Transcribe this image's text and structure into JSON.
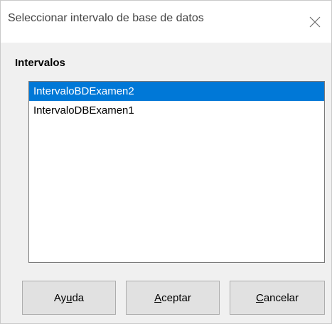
{
  "dialog": {
    "title": "Seleccionar intervalo de base de datos"
  },
  "ranges": {
    "label": "Intervalos",
    "items": [
      {
        "label": "IntervaloBDExamen2",
        "selected": true
      },
      {
        "label": "IntervaloDBExamen1",
        "selected": false
      }
    ]
  },
  "buttons": {
    "help": {
      "pre": "Ay",
      "mnemonic": "u",
      "post": "da"
    },
    "ok": {
      "pre": "",
      "mnemonic": "A",
      "post": "ceptar"
    },
    "cancel": {
      "pre": "",
      "mnemonic": "C",
      "post": "ancelar"
    }
  },
  "colors": {
    "selection": "#0078d7",
    "dialog_bg": "#f0f0f0"
  }
}
